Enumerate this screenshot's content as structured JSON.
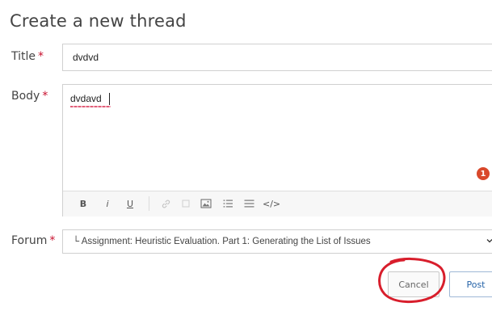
{
  "page": {
    "title": "Create a new thread"
  },
  "form": {
    "required_marker": "*",
    "title_field": {
      "label": "Title",
      "value": "dvdvd"
    },
    "body_field": {
      "label": "Body",
      "value": "dvdavd",
      "badge_count": "1"
    },
    "toolbar": {
      "bold": "B",
      "italic": "i",
      "underline": "U",
      "link_icon": "link-icon",
      "code_label": "</>"
    },
    "forum_field": {
      "label": "Forum",
      "selected": "└ Assignment: Heuristic Evaluation. Part 1: Generating the List of Issues"
    },
    "buttons": {
      "cancel": "Cancel",
      "post": "Post"
    }
  },
  "colors": {
    "required": "#c8102e",
    "badge": "#d9482b",
    "annotation": "#d81e2c",
    "post_text": "#2563a8"
  }
}
